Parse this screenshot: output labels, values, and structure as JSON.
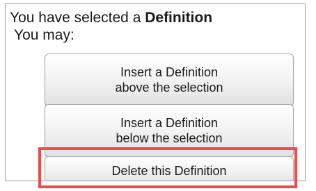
{
  "panel": {
    "heading_prefix": "You have selected a ",
    "heading_item": "Definition",
    "subheading": "You may:"
  },
  "actions": {
    "insert_above": {
      "line1": "Insert a Definition",
      "line2": "above the selection"
    },
    "insert_below": {
      "line1": "Insert a Definition",
      "line2": "below the selection"
    },
    "delete": {
      "label": "Delete this Definition"
    }
  },
  "highlight": {
    "target": "delete",
    "color": "#ef4b4b"
  }
}
